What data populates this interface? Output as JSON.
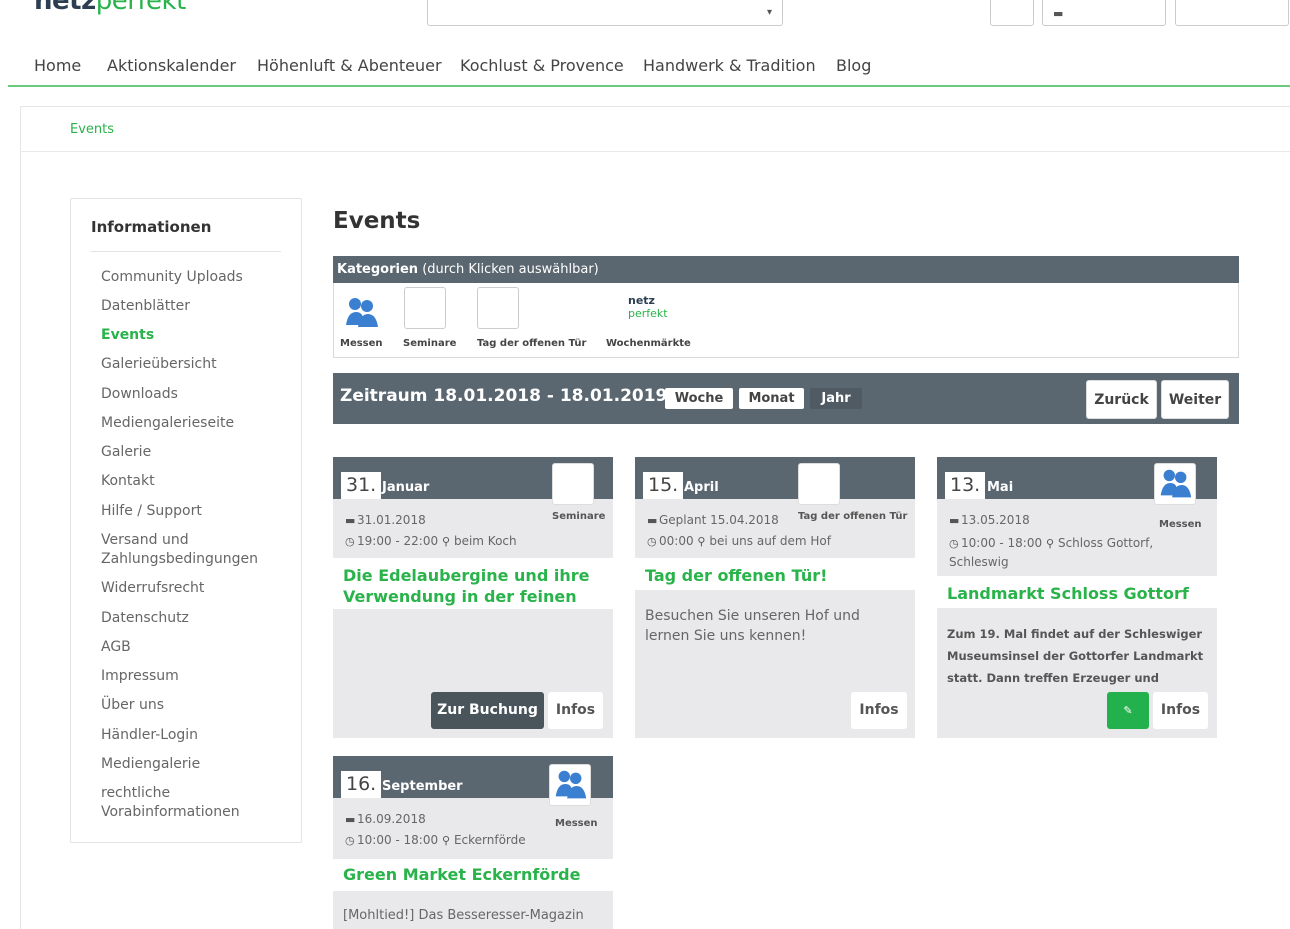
{
  "header": {
    "logo_dark": "netz",
    "logo_green": "perfekt",
    "search_caret": "▾"
  },
  "nav": [
    "Home",
    "Aktionskalender",
    "Höhenluft & Abenteuer",
    "Kochlust & Provence",
    "Handwerk & Tradition",
    "Blog"
  ],
  "breadcrumb": "Events",
  "sidebar": {
    "title": "Informationen",
    "items": [
      "Community Uploads",
      "Datenblätter",
      "Events",
      "Galerieübersicht",
      "Downloads",
      "Mediengalerieseite",
      "Galerie",
      "Kontakt",
      "Hilfe / Support",
      "Versand und Zahlungsbedingungen",
      "Widerrufsrecht",
      "Datenschutz",
      "AGB",
      "Impressum",
      "Über uns",
      "Händler-Login",
      "Mediengalerie",
      "rechtliche Vorabinformationen"
    ],
    "active_index": 2
  },
  "main": {
    "title": "Events",
    "categories": {
      "head_bold": "Kategorien",
      "head_rest": " (durch Klicken auswählbar)",
      "items": [
        "Messen",
        "Seminare",
        "Tag der offenen Tür",
        "Wochenmärkte"
      ],
      "logo_line1": "netz",
      "logo_line2": "perfekt"
    },
    "period": {
      "text": "Zeitraum 18.01.2018 - 18.01.2019",
      "buttons": [
        "Woche",
        "Monat",
        "Jahr"
      ],
      "prev": "Zurück",
      "next": "Weiter"
    },
    "events": [
      {
        "day": "31.",
        "month": "Januar",
        "category": "Seminare",
        "date": "31.01.2018",
        "time": "19:00 - 22:00",
        "location": "beim Koch",
        "title": "Die Edelaubergine und ihre Verwendung in der feinen",
        "desc": "",
        "btn_book": "Zur Buchung",
        "btn_info": "Infos"
      },
      {
        "day": "15.",
        "month": "April",
        "category": "Tag der offenen Tür",
        "date": "Geplant 15.04.2018",
        "time": "00:00",
        "location": "bei uns auf dem Hof",
        "title": "Tag der offenen Tür!",
        "desc": "Besuchen Sie unseren Hof und lernen Sie uns kennen!",
        "btn_info": "Infos"
      },
      {
        "day": "13.",
        "month": "Mai",
        "category": "Messen",
        "date": "13.05.2018",
        "time": "10:00 - 18:00",
        "location": "Schloss Gottorf, Schleswig",
        "title": "Landmarkt Schloss Gottorf",
        "desc": "Zum 19. Mal findet auf der Schleswiger Museumsinsel der Gottorfer Landmarkt statt. Dann treffen Erzeuger und",
        "btn_edit": "✎",
        "btn_info": "Infos"
      },
      {
        "day": "16.",
        "month": "September",
        "category": "Messen",
        "date": "16.09.2018",
        "time": "10:00 - 18:00",
        "location": "Eckernförde",
        "title": "Green Market Eckernförde",
        "desc": "[Mohltied!] Das Besseresser-Magazin"
      }
    ]
  },
  "icons": {
    "calendar": "▬",
    "clock": "◷",
    "pin": "⚲"
  },
  "colors": {
    "accent": "#29b34a",
    "bar": "#5b6770"
  }
}
